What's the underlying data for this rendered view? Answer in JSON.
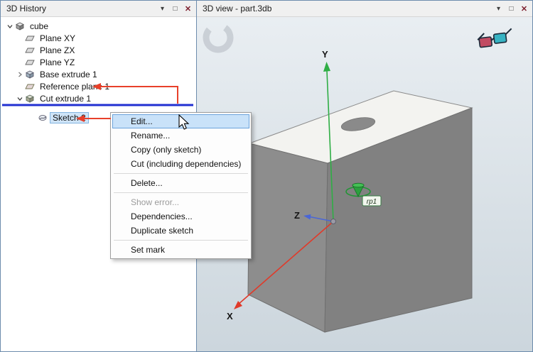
{
  "left_panel": {
    "title": "3D History",
    "tree": [
      {
        "label": "cube"
      },
      {
        "label": "Plane XY"
      },
      {
        "label": "Plane ZX"
      },
      {
        "label": "Plane YZ"
      },
      {
        "label": "Base extrude 1"
      },
      {
        "label": "Reference plane 1"
      },
      {
        "label": "Cut extrude 1"
      },
      {
        "label": "Sketch 2"
      }
    ]
  },
  "right_panel": {
    "title": "3D view - part.3db"
  },
  "icons": {
    "chevron_down": "▾",
    "float_window": "□",
    "close": "✕"
  },
  "context_menu": {
    "items": [
      {
        "label": "Edit..."
      },
      {
        "label": "Rename..."
      },
      {
        "label": "Copy (only sketch)"
      },
      {
        "label": "Cut (including dependencies)"
      },
      {
        "label": "Delete..."
      },
      {
        "label": "Show error..."
      },
      {
        "label": "Dependencies..."
      },
      {
        "label": "Duplicate sketch"
      },
      {
        "label": "Set mark"
      }
    ]
  },
  "viewport": {
    "x_label": "X",
    "y_label": "Y",
    "z_label": "Z",
    "marker_label": "rp1",
    "colors": {
      "x_axis": "#e03a2a",
      "y_axis": "#2fae45",
      "z_axis": "#4a66d6",
      "mark_line": "#2130d2",
      "annotation": "#e8402a"
    }
  }
}
